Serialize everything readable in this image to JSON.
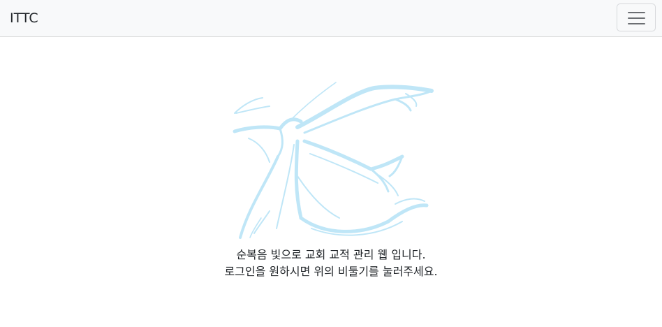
{
  "navbar": {
    "brand": "ITTC",
    "toggler_icon": "hamburger-menu-icon"
  },
  "main": {
    "dove_icon": "dove-icon",
    "dove_color": "#bfe6f7",
    "line1": "순복음 빛으로 교회 교적 관리 웹 입니다.",
    "line2": "로그인을 원하시면 위의 비둘기를 눌러주세요."
  }
}
